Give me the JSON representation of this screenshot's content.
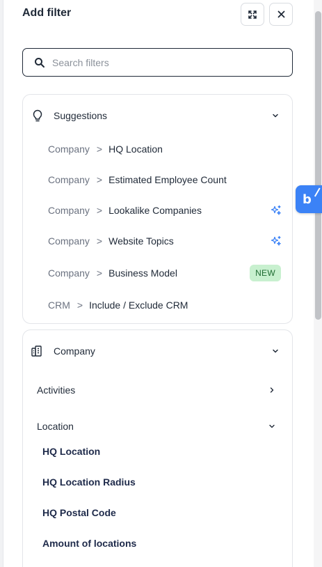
{
  "header": {
    "title": "Add filter"
  },
  "search": {
    "placeholder": "Search filters",
    "value": ""
  },
  "suggestions": {
    "title": "Suggestions",
    "items": [
      {
        "category": "Company",
        "separator": ">",
        "label": "HQ Location",
        "marker": ""
      },
      {
        "category": "Company",
        "separator": ">",
        "label": "Estimated Employee Count",
        "marker": ""
      },
      {
        "category": "Company",
        "separator": ">",
        "label": "Lookalike Companies",
        "marker": "sparkle-icon"
      },
      {
        "category": "Company",
        "separator": ">",
        "label": "Website Topics",
        "marker": "sparkle-icon"
      },
      {
        "category": "Company",
        "separator": ">",
        "label": "Business Model",
        "marker": "NEW"
      },
      {
        "category": "CRM",
        "separator": ">",
        "label": "Include / Exclude CRM",
        "marker": ""
      }
    ]
  },
  "company": {
    "title": "Company",
    "sections": [
      {
        "label": "Activities",
        "state": "collapsed"
      },
      {
        "label": "Location",
        "state": "expanded"
      }
    ],
    "location_items": [
      "HQ Location",
      "HQ Location Radius",
      "HQ Postal Code",
      "Amount of locations"
    ]
  },
  "extension": {
    "letter": "b"
  },
  "colors": {
    "accent": "#3b82f6",
    "badge_bg": "#c8f0cf",
    "badge_text": "#1f6b32",
    "sparkle": "#3b82f6"
  }
}
